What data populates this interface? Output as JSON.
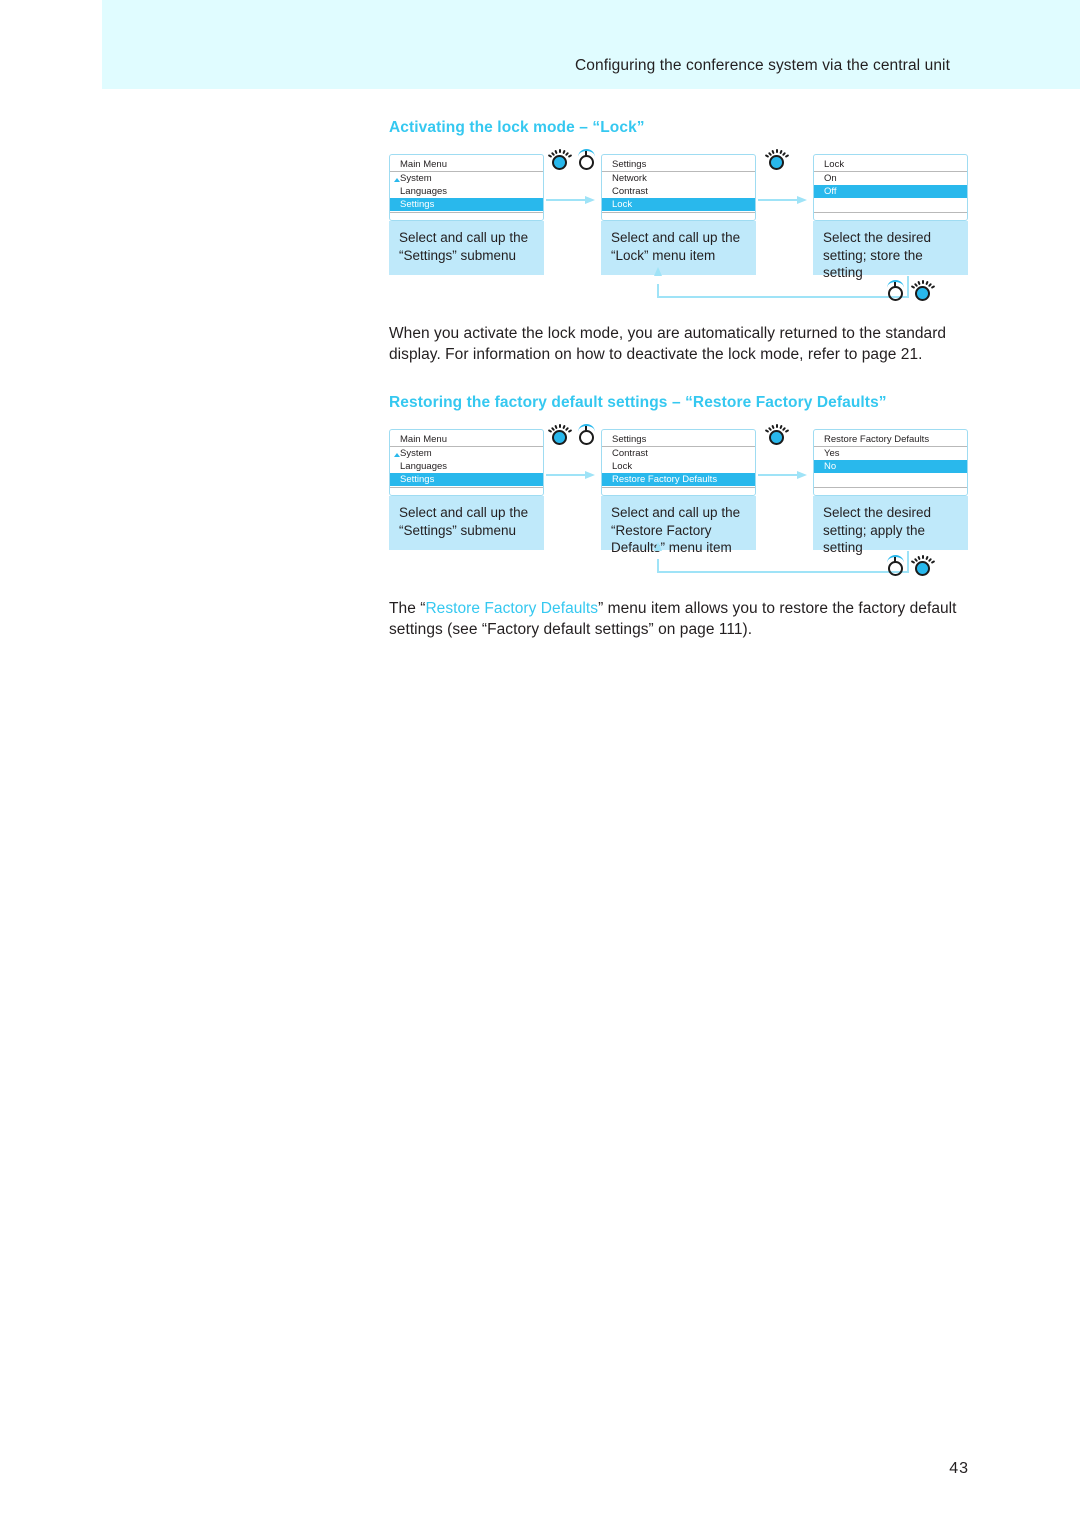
{
  "header": {
    "title": "Configuring the conference system via the central unit"
  },
  "page_number": "43",
  "colors": {
    "accent": "#35c8f0",
    "selected_row": "#29b8ec",
    "caption_bg": "#bfe9fa",
    "header_band": "#e0fcff",
    "arrow": "#9fe3f7"
  },
  "sections": [
    {
      "heading": "Activating the lock mode – “Lock”",
      "diagram": {
        "steps": [
          {
            "screen": {
              "title": "Main Menu",
              "rows": [
                {
                  "label": "System",
                  "bullet": true,
                  "selected": false
                },
                {
                  "label": "Languages",
                  "bullet": false,
                  "selected": false
                },
                {
                  "label": "Settings",
                  "bullet": false,
                  "selected": true
                }
              ]
            },
            "caption": "Select and call up the “Settings” submenu"
          },
          {
            "screen": {
              "title": "Settings",
              "rows": [
                {
                  "label": "Network",
                  "bullet": false,
                  "selected": false
                },
                {
                  "label": "Contrast",
                  "bullet": false,
                  "selected": false
                },
                {
                  "label": "Lock",
                  "bullet": false,
                  "selected": true
                }
              ]
            },
            "caption": "Select and call up the “Lock” menu item"
          },
          {
            "screen": {
              "title": "Lock",
              "rows": [
                {
                  "label": "On",
                  "bullet": false,
                  "selected": false
                },
                {
                  "label": "Off",
                  "bullet": false,
                  "selected": true
                },
                {
                  "label": "",
                  "bullet": false,
                  "selected": false
                }
              ]
            },
            "caption": "Select the desired setting; store the setting"
          }
        ],
        "controls": [
          {
            "icon": "rotary-knob-rotate-icon",
            "icon2": "rotary-knob-press-icon"
          },
          {
            "icon": "rotary-knob-rotate-icon",
            "icon2": null
          }
        ],
        "return_controls": {
          "icon": "rotary-knob-press-icon",
          "icon2": "rotary-knob-rotate-icon"
        }
      }
    },
    {
      "heading": "Restoring the factory default settings – “Restore Factory Defaults”",
      "diagram": {
        "steps": [
          {
            "screen": {
              "title": "Main Menu",
              "rows": [
                {
                  "label": "System",
                  "bullet": true,
                  "selected": false
                },
                {
                  "label": "Languages",
                  "bullet": false,
                  "selected": false
                },
                {
                  "label": "Settings",
                  "bullet": false,
                  "selected": true
                }
              ]
            },
            "caption": "Select and call up the “Settings” submenu"
          },
          {
            "screen": {
              "title": "Settings",
              "rows": [
                {
                  "label": "Contrast",
                  "bullet": false,
                  "selected": false
                },
                {
                  "label": "Lock",
                  "bullet": false,
                  "selected": false
                },
                {
                  "label": "Restore Factory Defaults",
                  "bullet": false,
                  "selected": true
                }
              ]
            },
            "caption": "Select and call up the “Restore Factory Defaults” menu item"
          },
          {
            "screen": {
              "title": "Restore Factory Defaults",
              "rows": [
                {
                  "label": "Yes",
                  "bullet": false,
                  "selected": false
                },
                {
                  "label": "No",
                  "bullet": false,
                  "selected": true
                },
                {
                  "label": "",
                  "bullet": false,
                  "selected": false
                }
              ]
            },
            "caption": "Select the desired setting; apply the setting"
          }
        ]
      }
    }
  ],
  "paragraphs": {
    "lock_note": "When you activate the lock mode, you are automatically returned to the standard display. For information on how to deactivate the lock mode, refer to page 21.",
    "restore_note_pre": "The “",
    "restore_note_accent": "Restore Factory Defaults",
    "restore_note_post": "” menu item allows you to restore the factory default settings (see “Factory default settings” on page 111)."
  }
}
